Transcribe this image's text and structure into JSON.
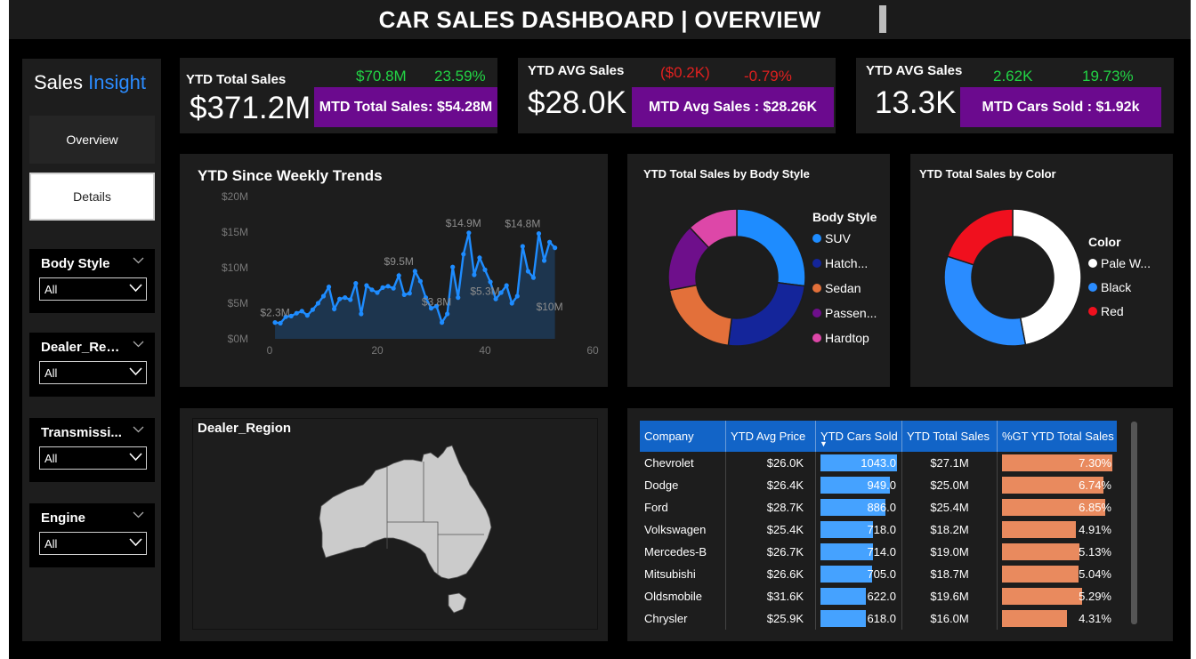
{
  "header": {
    "title": "CAR SALES DASHBOARD |  OVERVIEW"
  },
  "sidebar": {
    "brand_primary": "Sales",
    "brand_accent": "Insight",
    "nav": [
      {
        "label": "Overview"
      },
      {
        "label": "Details"
      }
    ],
    "slicers": [
      {
        "label": "Body Style",
        "value": "All"
      },
      {
        "label": "Dealer_Reg...",
        "value": "All"
      },
      {
        "label": "Transmissi...",
        "value": "All"
      },
      {
        "label": "Engine",
        "value": "All"
      }
    ]
  },
  "kpis": [
    {
      "label": "YTD Total Sales",
      "value": "$371.2M",
      "delta": "$70.8M",
      "delta_pct": "23.59%",
      "mtd": "MTD Total Sales: $54.28M",
      "trend": "up"
    },
    {
      "label": "YTD AVG Sales",
      "value": "$28.0K",
      "delta": "($0.2K)",
      "delta_pct": "-0.79%",
      "mtd": "MTD Avg Sales : $28.26K",
      "trend": "down"
    },
    {
      "label": "YTD AVG Sales",
      "value": "13.3K",
      "delta": "2.62K",
      "delta_pct": "19.73%",
      "mtd": "MTD Cars Sold : $1.92k",
      "trend": "up"
    }
  ],
  "colors": {
    "accent_blue": "#1e8cff",
    "purple": "#6b0a8e",
    "green": "#22d545",
    "red": "#e0201f",
    "orange": "#e98a5e"
  },
  "weekly_chart": {
    "title": "YTD Since Weekly Trends",
    "y_ticks": [
      "$0M",
      "$5M",
      "$10M",
      "$15M",
      "$20M"
    ],
    "x_ticks": [
      "0",
      "20",
      "40",
      "60"
    ],
    "annotations": [
      {
        "text": "$2.3M",
        "x": 1,
        "y": 2.3
      },
      {
        "text": "$9.5M",
        "x": 24,
        "y": 9.5
      },
      {
        "text": "$14.9M",
        "x": 36,
        "y": 14.9
      },
      {
        "text": "$14.8M",
        "x": 47,
        "y": 14.8
      },
      {
        "text": "$3.8M",
        "x": 31,
        "y": 3.8
      },
      {
        "text": "$5.3M",
        "x": 40,
        "y": 5.3
      },
      {
        "text": "$10M",
        "x": 52,
        "y": 3.1
      }
    ]
  },
  "chart_data": [
    {
      "type": "area",
      "title": "YTD Since Weekly Trends",
      "xlim": [
        0,
        60
      ],
      "ylim": [
        0,
        20
      ],
      "x": [
        1,
        2,
        3,
        4,
        5,
        6,
        7,
        8,
        9,
        10,
        11,
        12,
        13,
        14,
        15,
        16,
        17,
        18,
        19,
        20,
        21,
        22,
        23,
        24,
        25,
        26,
        27,
        28,
        29,
        30,
        31,
        32,
        33,
        34,
        35,
        36,
        37,
        38,
        39,
        40,
        41,
        42,
        43,
        44,
        45,
        46,
        47,
        48,
        49,
        50,
        51,
        52,
        53
      ],
      "values": [
        2.3,
        2.2,
        3.1,
        3.2,
        3.6,
        3.9,
        3.3,
        4.1,
        5.0,
        6.0,
        7.3,
        4.2,
        5.6,
        5.8,
        5.5,
        7.8,
        3.5,
        7.5,
        6.9,
        6.5,
        7.2,
        7.4,
        7.1,
        8.9,
        6.2,
        6.4,
        9.5,
        8.1,
        5.8,
        4.3,
        4.6,
        2.3,
        3.5,
        10.1,
        5.8,
        11.9,
        14.9,
        9.0,
        11.4,
        9.7,
        8.0,
        5.6,
        6.5,
        7.5,
        5.0,
        6.0,
        13.0,
        9.5,
        8.6,
        14.8,
        11.0,
        13.6,
        12.8,
        12.5,
        10.0,
        0.9
      ],
      "units": "$M"
    },
    {
      "type": "pie",
      "title": "YTD Total Sales by Body Style",
      "legend_title": "Body Style",
      "categories": [
        "SUV",
        "Hatch...",
        "Sedan",
        "Passen...",
        "Hardtop"
      ],
      "values": [
        27,
        25,
        20,
        16,
        12
      ],
      "colors": [
        "#1e8cff",
        "#14259a",
        "#e3703a",
        "#6e0f8b",
        "#dd47a8"
      ]
    },
    {
      "type": "pie",
      "title": "YTD Total Sales by Color",
      "legend_title": "Color",
      "categories": [
        "Pale W...",
        "Black",
        "Red"
      ],
      "values": [
        47,
        33,
        20
      ],
      "colors": [
        "#ffffff",
        "#2a8cff",
        "#f0101e"
      ]
    },
    {
      "type": "table",
      "title": "",
      "columns": [
        "Company",
        "YTD Avg Price",
        "YTD Cars Sold",
        "YTD Total Sales",
        "%GT YTD Total Sales"
      ],
      "rows": [
        {
          "company": "Chevrolet",
          "avg_price": "$26.0K",
          "cars_sold": 1043.0,
          "cars_sold_label": "1043.0",
          "total_sales": "$27.1M",
          "pct": 7.3,
          "pct_label": "7.30%"
        },
        {
          "company": "Dodge",
          "avg_price": "$26.4K",
          "cars_sold": 949.0,
          "cars_sold_label": "949.0",
          "total_sales": "$25.0M",
          "pct": 6.74,
          "pct_label": "6.74%"
        },
        {
          "company": "Ford",
          "avg_price": "$28.7K",
          "cars_sold": 886.0,
          "cars_sold_label": "886.0",
          "total_sales": "$25.4M",
          "pct": 6.85,
          "pct_label": "6.85%"
        },
        {
          "company": "Volkswagen",
          "avg_price": "$25.4K",
          "cars_sold": 718.0,
          "cars_sold_label": "718.0",
          "total_sales": "$18.2M",
          "pct": 4.91,
          "pct_label": "4.91%"
        },
        {
          "company": "Mercedes-B",
          "avg_price": "$26.7K",
          "cars_sold": 714.0,
          "cars_sold_label": "714.0",
          "total_sales": "$19.0M",
          "pct": 5.13,
          "pct_label": "5.13%"
        },
        {
          "company": "Mitsubishi",
          "avg_price": "$26.6K",
          "cars_sold": 705.0,
          "cars_sold_label": "705.0",
          "total_sales": "$18.7M",
          "pct": 5.04,
          "pct_label": "5.04%"
        },
        {
          "company": "Oldsmobile",
          "avg_price": "$31.6K",
          "cars_sold": 622.0,
          "cars_sold_label": "622.0",
          "total_sales": "$19.6M",
          "pct": 5.29,
          "pct_label": "5.29%"
        },
        {
          "company": "Chrysler",
          "avg_price": "$25.9K",
          "cars_sold": 618.0,
          "cars_sold_label": "618.0",
          "total_sales": "$16.0M",
          "pct": 4.31,
          "pct_label": "4.31%"
        }
      ]
    }
  ],
  "body_style_chart": {
    "title": "YTD Total Sales by Body Style",
    "legend_title": "Body Style"
  },
  "color_chart": {
    "title": "YTD Total Sales by Color",
    "legend_title": "Color"
  },
  "map": {
    "title": "Dealer_Region"
  }
}
